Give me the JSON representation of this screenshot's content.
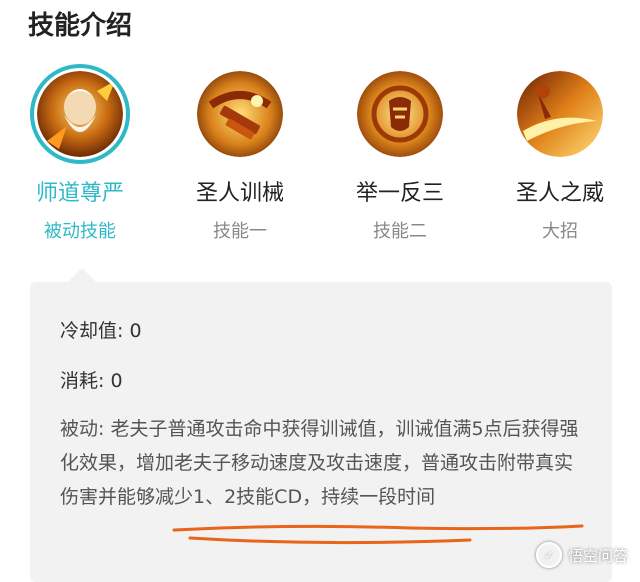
{
  "header": {
    "title": "技能介绍"
  },
  "skills": [
    {
      "name": "师道尊严",
      "type": "被动技能",
      "icon": "sage-portrait-icon",
      "active": true
    },
    {
      "name": "圣人训械",
      "type": "技能一",
      "icon": "scroll-weapon-icon",
      "active": false
    },
    {
      "name": "举一反三",
      "type": "技能二",
      "icon": "sage-face-icon",
      "active": false
    },
    {
      "name": "圣人之威",
      "type": "大招",
      "icon": "flame-sweep-icon",
      "active": false
    }
  ],
  "details": {
    "cooldown": "冷却值: 0",
    "cost": "消耗: 0",
    "description": "被动: 老夫子普通攻击命中获得训诫值，训诫值满5点后获得强化效果，增加老夫子移动速度及攻击速度，普通攻击附带真实伤害并能够减少1、2技能CD，持续一段时间"
  },
  "annotation": {
    "underline_color": "#e8651a"
  },
  "watermark": {
    "text": "悟空问答"
  },
  "colors": {
    "accent": "#2fb9c7",
    "panel_bg": "#f2f2f2"
  }
}
